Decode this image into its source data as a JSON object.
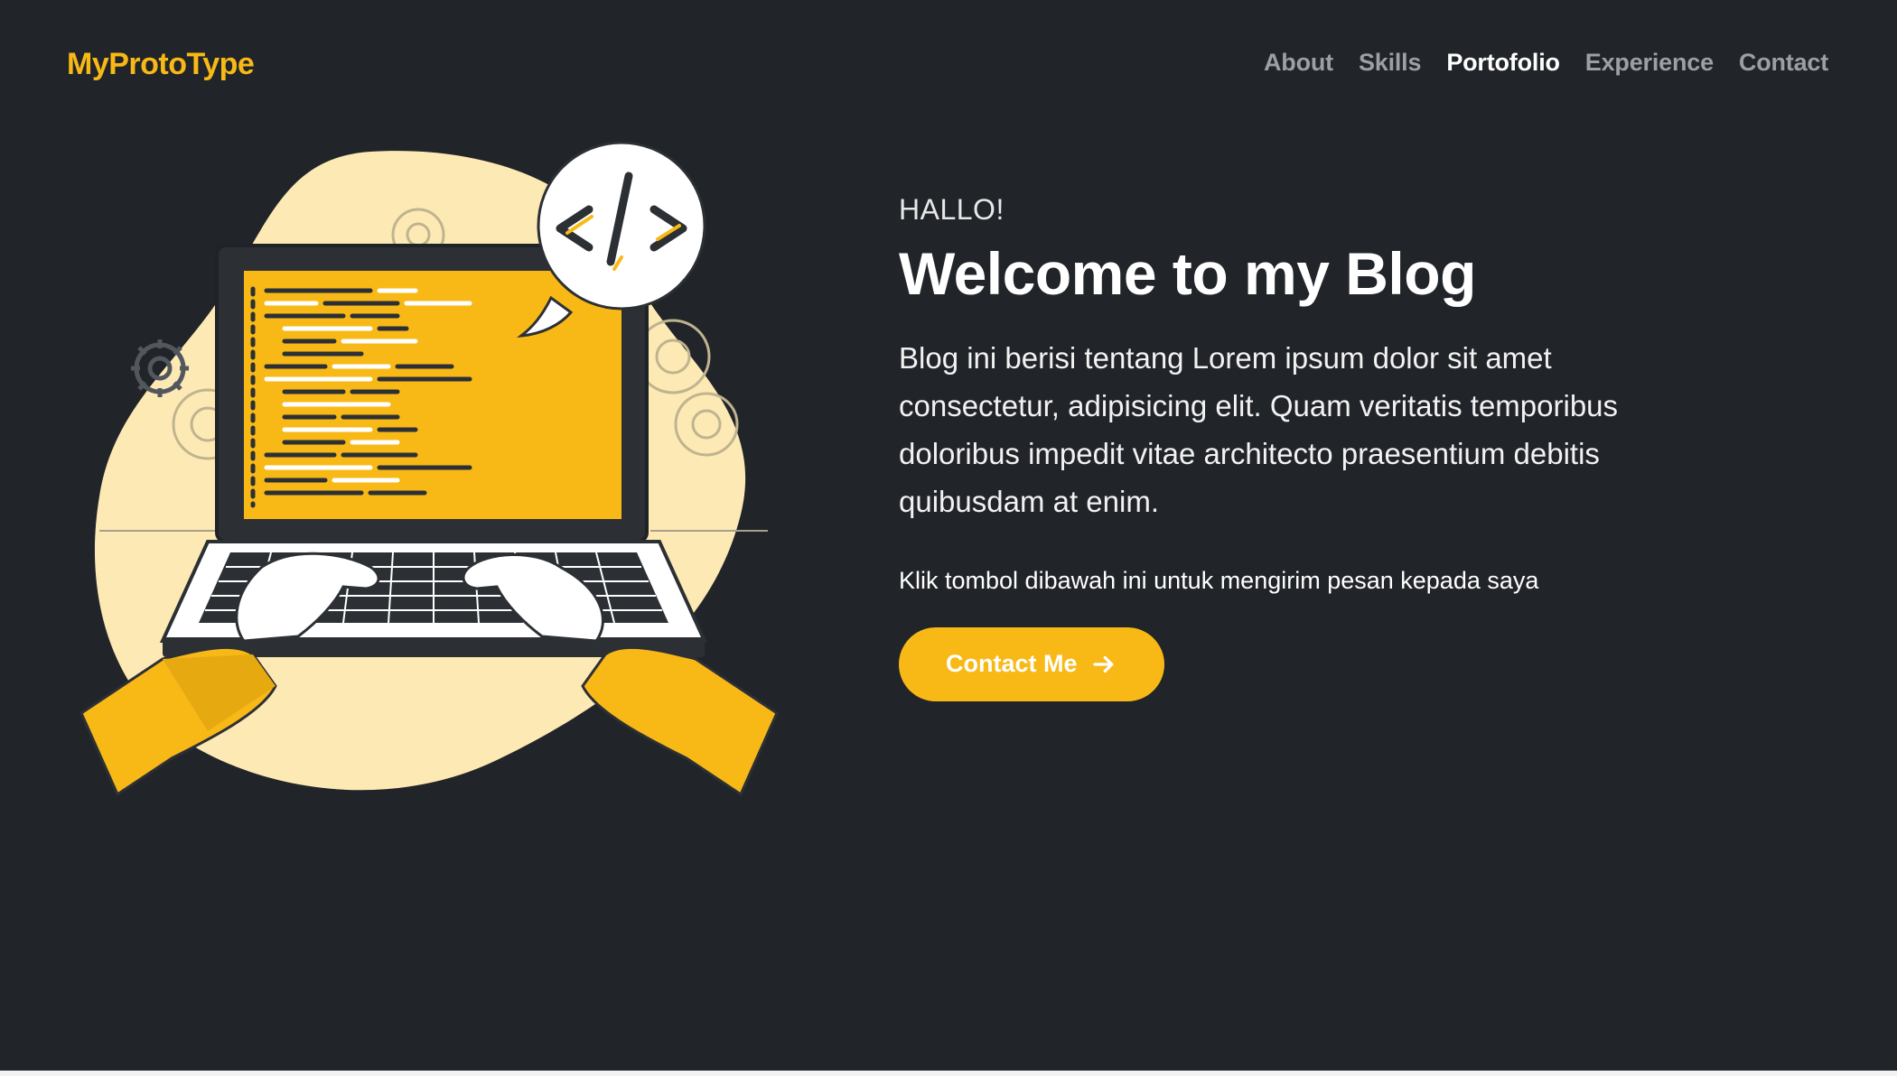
{
  "brand": {
    "name": "MyProtoType",
    "color": "#f8b917"
  },
  "nav": {
    "items": [
      {
        "label": "About",
        "active": false
      },
      {
        "label": "Skills",
        "active": false
      },
      {
        "label": "Portofolio",
        "active": true
      },
      {
        "label": "Experience",
        "active": false
      },
      {
        "label": "Contact",
        "active": false
      }
    ]
  },
  "hero": {
    "greeting": "HALLO!",
    "headline": "Welcome to my Blog",
    "intro": "Blog ini berisi tentang Lorem ipsum dolor sit amet consectetur, adipisicing elit. Quam veritatis temporibus doloribus impedit vitae architecto praesentium debitis quibusdam at enim.",
    "cta_note": "Klik tombol dibawah ini untuk mengirim pesan kepada saya",
    "cta_label": "Contact Me",
    "cta_icon": "arrow-right-icon"
  },
  "illustration": {
    "subject": "hands-typing-on-laptop",
    "icons": [
      "code-brackets-icon",
      "gear-icon"
    ]
  },
  "colors": {
    "background": "#212429",
    "accent": "#f8b917",
    "blob": "#fde9b4",
    "nav_inactive": "#9aa0a6",
    "nav_active": "#ffffff"
  }
}
